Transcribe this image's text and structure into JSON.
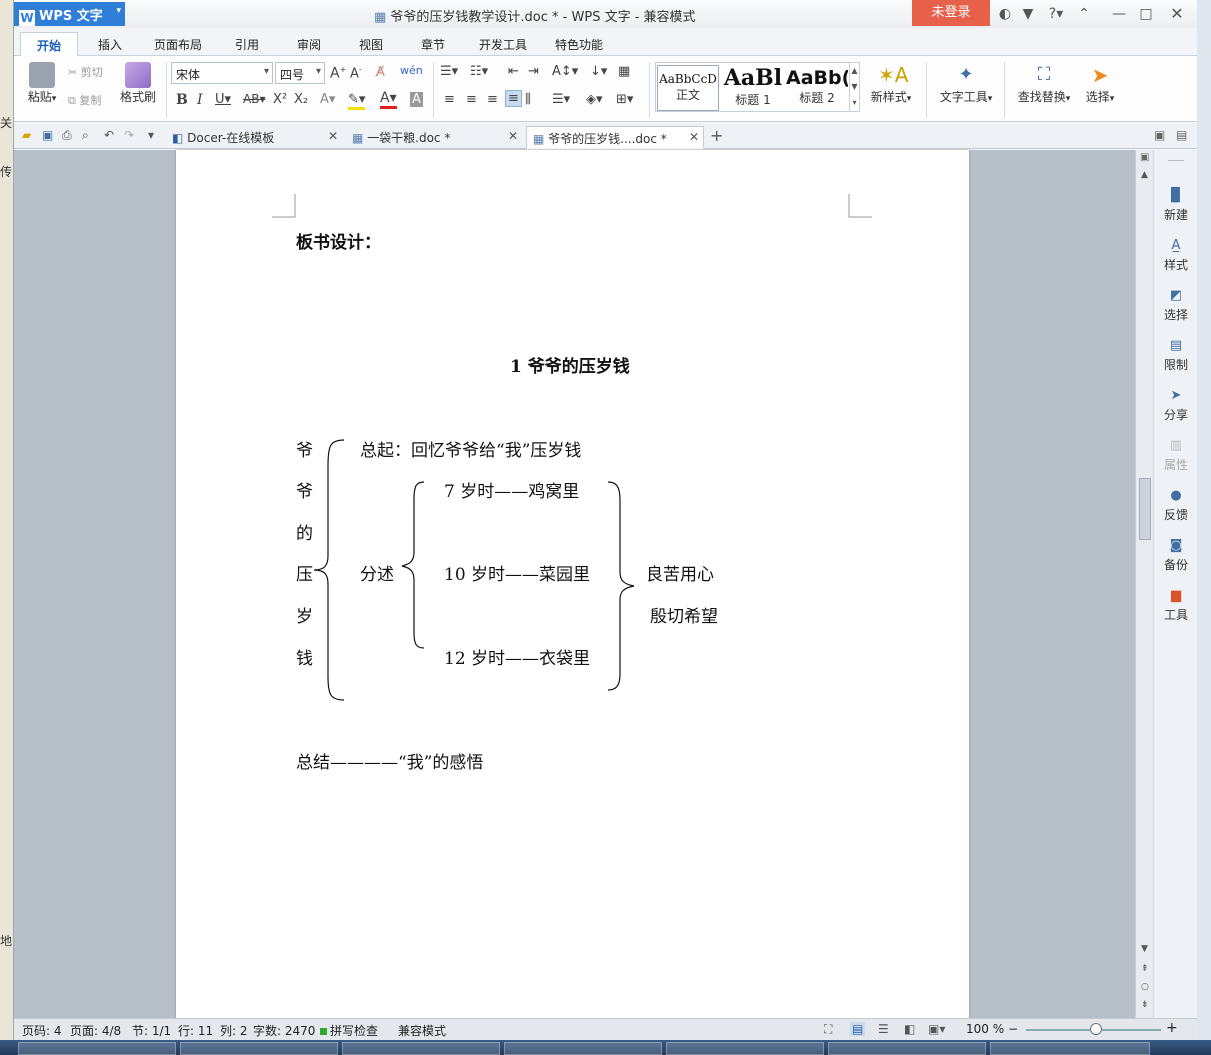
{
  "window": {
    "title": "爷爷的压岁钱教学设计.doc * - WPS 文字 - 兼容模式",
    "app_button": "WPS 文字",
    "login": "未登录",
    "accent": "#2f7ed8",
    "login_color": "#e7604a"
  },
  "ribbon_tabs": [
    "开始",
    "插入",
    "页面布局",
    "引用",
    "审阅",
    "视图",
    "章节",
    "开发工具",
    "特色功能"
  ],
  "ribbon": {
    "paste": "粘贴",
    "cut": "剪切",
    "copy": "复制",
    "format_painter": "格式刷",
    "font_name": "宋体",
    "font_size": "四号",
    "styles": [
      {
        "preview": "AaBbCcD",
        "name": "正文"
      },
      {
        "preview": "AaBl",
        "name": "标题 1"
      },
      {
        "preview": "AaBb(",
        "name": "标题 2"
      }
    ],
    "new_style": "新样式",
    "text_tools": "文字工具",
    "find_replace": "查找替换",
    "select": "选择"
  },
  "doc_tabs": [
    {
      "label": "Docer-在线模板",
      "active": false
    },
    {
      "label": "一袋干粮.doc *",
      "active": false
    },
    {
      "label": "爷爷的压岁钱....doc *",
      "active": true
    }
  ],
  "document": {
    "heading": "板书设计：",
    "title": "1 爷爷的压岁钱",
    "left_chars": [
      "爷",
      "爷",
      "的",
      "压",
      "岁",
      "钱"
    ],
    "intro": "总起：回忆爷爷给“我”压岁钱",
    "fenshu": "分述",
    "items": [
      "7 岁时——鸡窝里",
      "10 岁时——菜园里",
      "12 岁时——衣袋里"
    ],
    "right1": "良苦用心",
    "right2": "殷切希望",
    "summary": "总结————“我”的感悟"
  },
  "right_panel": [
    {
      "label": "新建",
      "icon": "new-doc-icon",
      "disabled": false
    },
    {
      "label": "样式",
      "icon": "style-icon",
      "disabled": false
    },
    {
      "label": "选择",
      "icon": "select-icon",
      "disabled": false
    },
    {
      "label": "限制",
      "icon": "restrict-icon",
      "disabled": false
    },
    {
      "label": "分享",
      "icon": "share-icon",
      "disabled": false
    },
    {
      "label": "属性",
      "icon": "properties-icon",
      "disabled": true
    },
    {
      "label": "反馈",
      "icon": "feedback-icon",
      "disabled": false
    },
    {
      "label": "备份",
      "icon": "backup-icon",
      "disabled": false
    },
    {
      "label": "工具",
      "icon": "toolbox-icon",
      "disabled": false
    }
  ],
  "status": {
    "page_code": "页码: 4",
    "pages": "页面: 4/8",
    "section": "节: 1/1",
    "row": "行: 11",
    "col": "列: 2",
    "words": "字数: 2470",
    "spell": "拼写检查",
    "compat": "兼容模式",
    "zoom": "100 %",
    "zoom_level": 100
  },
  "background_left": [
    "关",
    "传",
    "地"
  ]
}
